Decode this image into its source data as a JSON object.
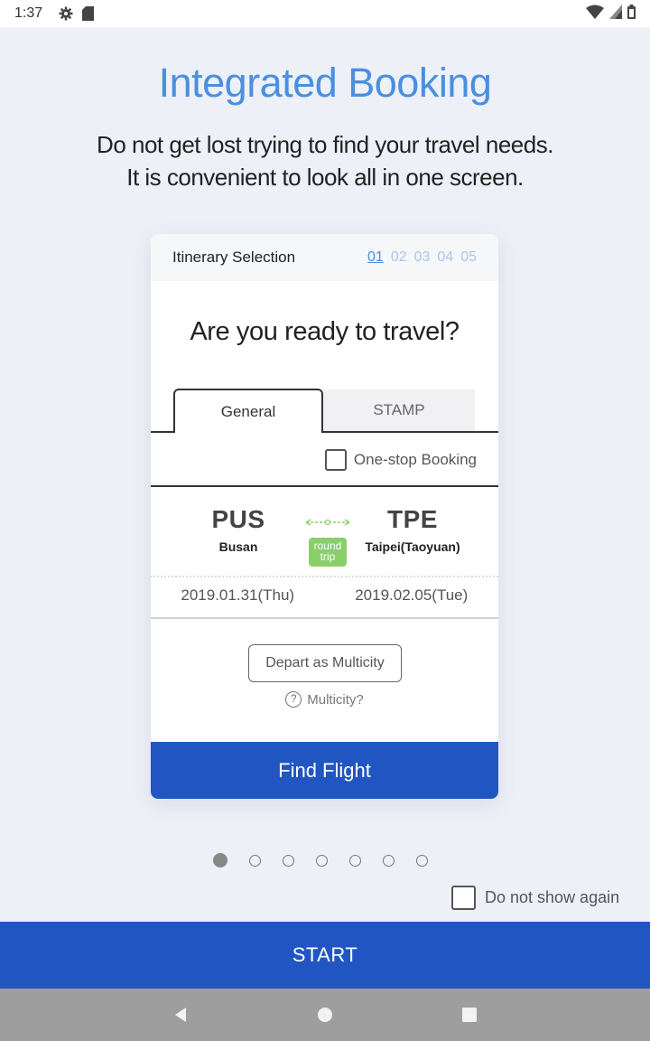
{
  "status_bar": {
    "time": "1:37",
    "icons": [
      "gear-icon",
      "sd-card-icon",
      "wifi-icon",
      "signal-icon",
      "battery-icon"
    ]
  },
  "hero": {
    "title": "Integrated Booking",
    "subtitle_line1": "Do not get lost trying to find your travel needs.",
    "subtitle_line2": "It is convenient to look all in one screen."
  },
  "card": {
    "header_title": "Itinerary Selection",
    "steps": [
      "01",
      "02",
      "03",
      "04",
      "05"
    ],
    "active_step": "01",
    "question": "Are you ready to travel?",
    "tabs": {
      "general": "General",
      "stamp": "STAMP"
    },
    "one_stop_label": "One-stop Booking",
    "from": {
      "code": "PUS",
      "name": "Busan"
    },
    "to": {
      "code": "TPE",
      "name": "Taipei(Taoyuan)"
    },
    "trip_type_line1": "round",
    "trip_type_line2": "trip",
    "depart_date": "2019.01.31(Thu)",
    "return_date": "2019.02.05(Tue)",
    "multicity_button": "Depart as Multicity",
    "multicity_help": "Multicity?",
    "find_button": "Find Flight"
  },
  "pager": {
    "total": 7,
    "active": 1
  },
  "dont_show_label": "Do not show again",
  "start_button": "START",
  "colors": {
    "accent_blue": "#2156c2",
    "title_blue": "#4a8fe0",
    "round_trip_green": "#8bcf6b",
    "background": "#eef0f7"
  }
}
